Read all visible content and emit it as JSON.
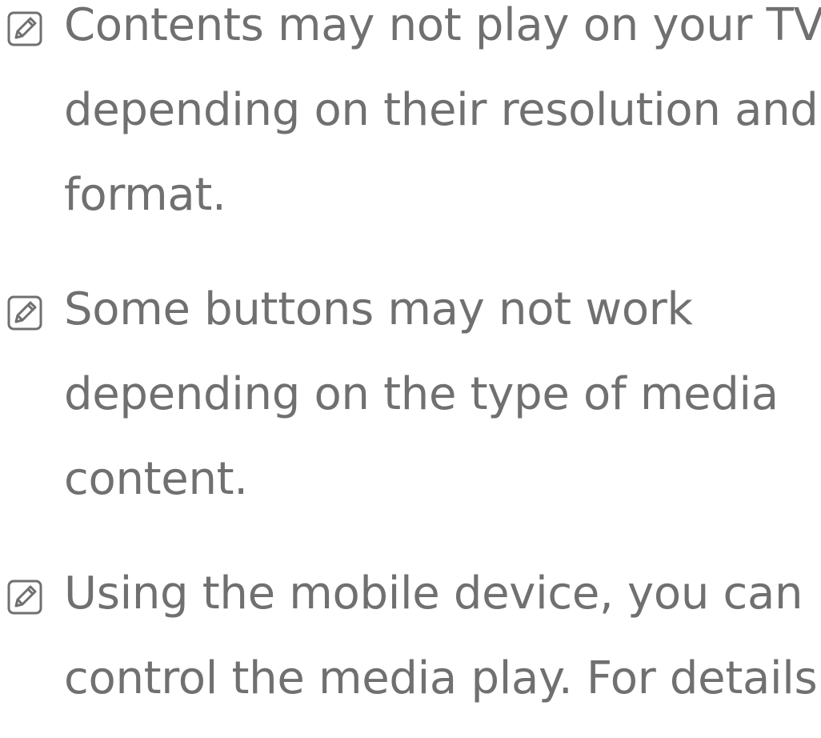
{
  "notes": [
    {
      "icon": "note-pencil-icon",
      "lines": [
        "Contents may not play on your TV",
        "depending on their resolution and",
        "format."
      ]
    },
    {
      "icon": "note-pencil-icon",
      "lines": [
        "Some buttons may not work",
        "depending on the type of media",
        "content."
      ]
    },
    {
      "icon": "note-pencil-icon",
      "lines": [
        "Using the mobile device, you can",
        "control the media play. For details,"
      ]
    }
  ],
  "colors": {
    "text": "#707070",
    "icon": "#707070",
    "background": "#ffffff"
  }
}
